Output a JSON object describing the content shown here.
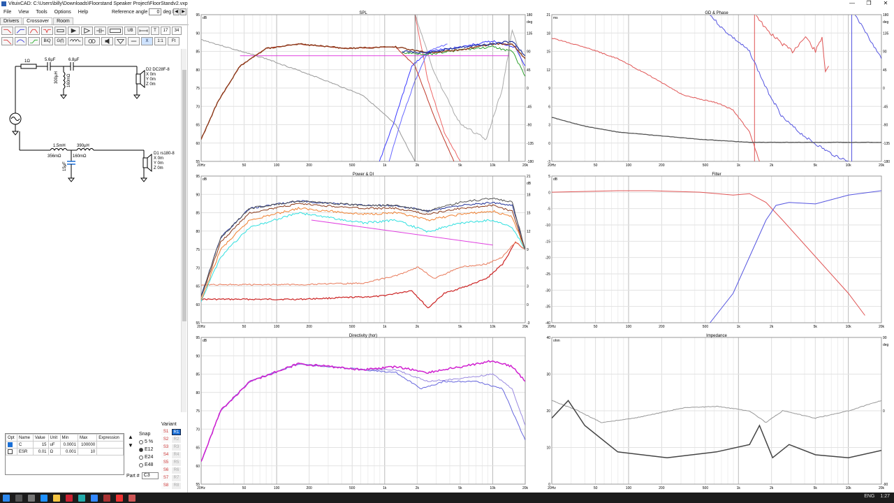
{
  "window": {
    "title": "VituixCAD: C:\\Users\\billy\\Downloads\\Floorstand Speaker Project\\FloorStandv2.vxp",
    "min": "—",
    "max": "❐",
    "close": "✕"
  },
  "menu": [
    "File",
    "View",
    "Tools",
    "Options",
    "Help"
  ],
  "reference": {
    "label": "Reference angle",
    "value": "0",
    "unit": "deg hor"
  },
  "tabs": [
    {
      "label": "Drivers"
    },
    {
      "label": "Crossover"
    },
    {
      "label": "Room"
    }
  ],
  "toolbar": {
    "biq": "BiQ",
    "gs": "G(f)",
    "ub": "UB",
    "t": "T",
    "n17": "17",
    "n34": "34",
    "x": "X",
    "r11": "1:1",
    "ft": "Ft"
  },
  "schematic": {
    "r1": "1Ω",
    "c1": "5.6µF",
    "c2": "6.8µF",
    "l1": "300µH",
    "l1r": "160mΩ",
    "d2name": "D2 DC28F-8",
    "d2x": "X 0m",
    "d2y": "Y 0m",
    "d2z": "Z 0m",
    "l2": "1.5mH",
    "l2r": "356mΩ",
    "l3": "390µH",
    "l3r": "160mΩ",
    "c3": "15µF",
    "d1name": "D1 rs180-8",
    "d1x": "X 0m",
    "d1y": "Y 0m",
    "d1z": "Z 0m"
  },
  "props": {
    "headers": [
      "Opt",
      "Name",
      "Value",
      "Unit",
      "Min",
      "Max",
      "Expression"
    ],
    "rows": [
      [
        "C",
        "15",
        "uF",
        "0.0001",
        "100000",
        ""
      ],
      [
        "ESR",
        "0.01",
        "Ω",
        "0.001",
        "10",
        ""
      ]
    ]
  },
  "snap": {
    "label": "Snap",
    "options": [
      "5 %",
      "E12",
      "E24",
      "E48"
    ],
    "selected": 1
  },
  "partno": {
    "label": "Part #",
    "value": "C3"
  },
  "variant": {
    "label": "Variant",
    "s": [
      "S1",
      "S2",
      "S3",
      "S4",
      "S5",
      "S6",
      "S7",
      "S8"
    ],
    "r": [
      "R1",
      "R2",
      "R3",
      "R4",
      "R5",
      "R6",
      "R7",
      "R8"
    ]
  },
  "plots": {
    "spl": {
      "title": "SPL",
      "unitL": "dB",
      "unitR": "deg",
      "yL": [
        "95",
        "90",
        "85",
        "80",
        "75",
        "70",
        "65",
        "60",
        "55"
      ],
      "yR": [
        "180",
        "135",
        "90",
        "45",
        "0",
        "-45",
        "-90",
        "-135",
        "-180"
      ]
    },
    "gd": {
      "title": "GD & Phase",
      "unitL": "ms",
      "unitR": "deg",
      "yL": [
        "21",
        "18",
        "15",
        "12",
        "9",
        "6",
        "3",
        "0",
        "-3"
      ],
      "yR": [
        "180",
        "135",
        "90",
        "45",
        "0",
        "-45",
        "-90",
        "-135",
        "-180"
      ]
    },
    "pow": {
      "title": "Power & DI",
      "unitL": "dB",
      "unitR": "dB",
      "yL": [
        "95",
        "90",
        "85",
        "80",
        "75",
        "70",
        "65",
        "60",
        "55"
      ],
      "yR": [
        "21",
        "18",
        "15",
        "12",
        "9",
        "6",
        "3",
        "0",
        "-3"
      ]
    },
    "filt": {
      "title": "Filter",
      "unitL": "dB",
      "unitR": "",
      "yL": [
        "5",
        "0",
        "-5",
        "-10",
        "-15",
        "-20",
        "-25",
        "-30",
        "-35",
        "-40"
      ],
      "yR": []
    },
    "dir": {
      "title": "Directivity (hor)",
      "unitL": "dB",
      "unitR": "",
      "yL": [
        "95",
        "90",
        "85",
        "80",
        "75",
        "70",
        "65",
        "60",
        "55"
      ],
      "yR": []
    },
    "imp": {
      "title": "Impedance",
      "unitL": "ohm",
      "unitR": "deg",
      "yL": [
        "40",
        "30",
        "20",
        "10",
        "0"
      ],
      "yR": [
        "90",
        "0",
        "-90"
      ]
    }
  },
  "xticks": [
    "20Hz",
    "50",
    "100",
    "200",
    "500",
    "1k",
    "2k",
    "5k",
    "10k",
    "20k"
  ],
  "taskbar": {
    "lang": "ENG",
    "time": "1:27"
  },
  "colors": {
    "woofer": "#c0392b",
    "tweeter": "#3a3aff",
    "sum": "#333",
    "green": "#2ea02e",
    "magenta": "#e040e0",
    "orange": "#f08030",
    "cyan": "#30e0e0",
    "brown": "#8b3a1a"
  }
}
